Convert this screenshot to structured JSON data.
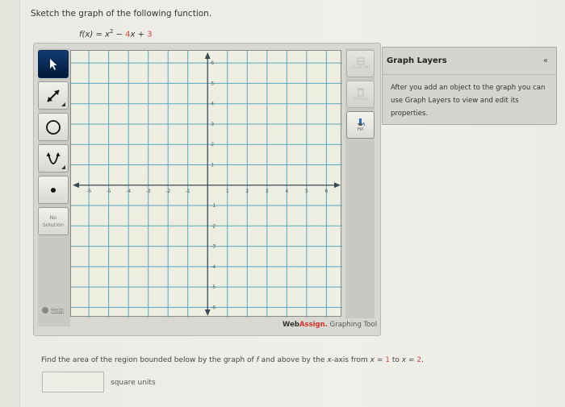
{
  "problem": {
    "prompt": "Sketch the graph of the following function.",
    "function": {
      "lhs": "f(x) = x",
      "exponent": "2",
      "op1": " − ",
      "coef": "4",
      "var": "x",
      "op2": " + ",
      "const": "3"
    }
  },
  "toolbar": {
    "tools": [
      {
        "name": "select-tool",
        "icon": "pointer-arrow-icon",
        "active": true
      },
      {
        "name": "line-tool",
        "icon": "double-arrow-line-icon",
        "active": false
      },
      {
        "name": "circle-tool",
        "icon": "circle-icon",
        "active": false
      },
      {
        "name": "parabola-tool",
        "icon": "parabola-icon",
        "active": false
      },
      {
        "name": "point-tool",
        "icon": "point-dot-icon",
        "active": false
      }
    ],
    "no_solution_line1": "No",
    "no_solution_line2": "Solution",
    "help_label": "Help"
  },
  "right_tools": {
    "clear_all": "Clear All",
    "delete": "Delete",
    "fill": "Fill"
  },
  "credit": {
    "web": "Web",
    "assign": "Assign.",
    "rest": " Graphing Tool"
  },
  "layers": {
    "title": "Graph Layers",
    "collapse": "«",
    "body": "After you add an object to the graph you can use Graph Layers to view and edit its properties."
  },
  "grid": {
    "x_range": [
      -6.9,
      6.8
    ],
    "y_range": [
      -6.5,
      6.6
    ],
    "x_ticks": [
      -6,
      -5,
      -4,
      -3,
      -2,
      -1,
      1,
      2,
      3,
      4,
      5,
      6
    ],
    "y_ticks": [
      -6,
      -5,
      -4,
      -3,
      -2,
      -1,
      1,
      2,
      3,
      4,
      5,
      6
    ],
    "grid_color": "#5aa5bf",
    "axis_color": "#3c4a55"
  },
  "question": {
    "text_before": "Find the area of the region bounded below by the graph of ",
    "f": "f",
    "text_mid": " and above by the ",
    "xaxis": "x",
    "text_axis": "-axis from ",
    "x1_var": "x",
    "eq": " = ",
    "x1": "1",
    "to": " to ",
    "x2_var": "x",
    "x2": "2",
    "period": "."
  },
  "answer": {
    "value": "",
    "units": "square units"
  }
}
